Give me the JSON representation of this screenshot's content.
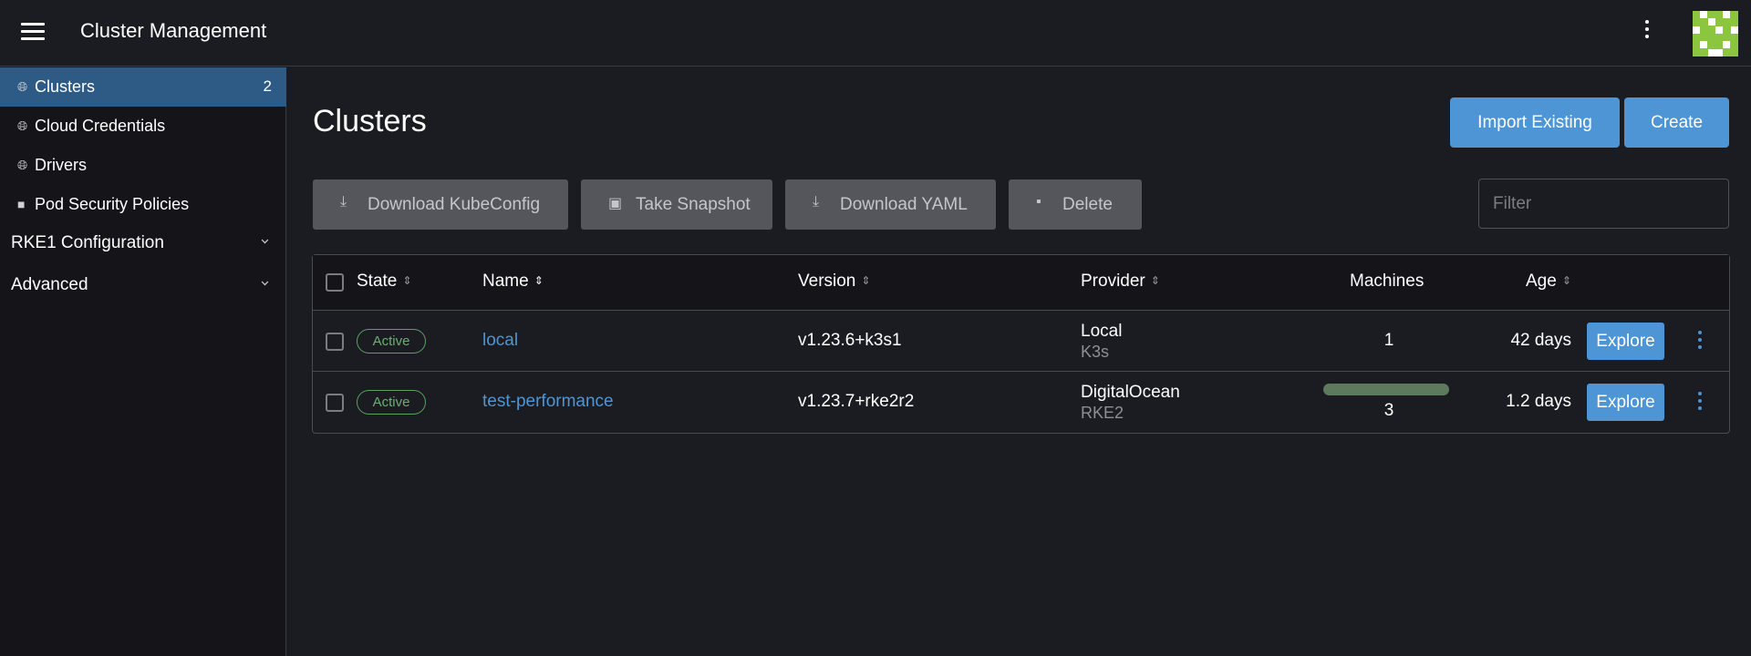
{
  "header": {
    "title": "Cluster Management",
    "menu_icon": "hamburger-icon",
    "more_icon": "kebab-icon",
    "avatar_color": "#8cc63f"
  },
  "sidebar": {
    "items": [
      {
        "label": "Clusters",
        "icon": "globe-icon",
        "count": "2"
      },
      {
        "label": "Cloud Credentials",
        "icon": "globe-icon"
      },
      {
        "label": "Drivers",
        "icon": "globe-icon"
      },
      {
        "label": "Pod Security Policies",
        "icon": "folder-icon"
      }
    ],
    "groups": [
      {
        "label": "RKE1 Configuration"
      },
      {
        "label": "Advanced"
      }
    ]
  },
  "main": {
    "title": "Clusters",
    "import_label": "Import Existing",
    "create_label": "Create",
    "actions": {
      "download_kubeconfig": "Download KubeConfig",
      "take_snapshot": "Take Snapshot",
      "download_yaml": "Download YAML",
      "delete": "Delete"
    },
    "filter_placeholder": "Filter"
  },
  "table": {
    "headers": {
      "state": "State",
      "name": "Name",
      "version": "Version",
      "provider": "Provider",
      "machines": "Machines",
      "age": "Age"
    },
    "rows": [
      {
        "state": "Active",
        "name": "local",
        "version": "v1.23.6+k3s1",
        "provider": "Local",
        "provider_sub": "K3s",
        "machines": "1",
        "age": "42 days",
        "action": "Explore"
      },
      {
        "state": "Active",
        "name": "test-performance",
        "version": "v1.23.7+rke2r2",
        "provider": "DigitalOcean",
        "provider_sub": "RKE2",
        "machines": "3",
        "machines_progress": 1.0,
        "age": "1.2 days",
        "action": "Explore"
      }
    ]
  },
  "colors": {
    "accent": "#4d95d4",
    "active_nav": "#2e5a86",
    "status_active": "#6cae72"
  }
}
